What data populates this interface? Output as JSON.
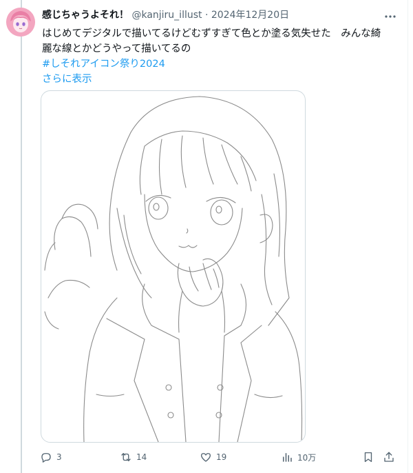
{
  "tweet": {
    "display_name": "感じちゃうよそれ！",
    "handle": "@kanjiru_illust",
    "separator": "·",
    "date": "2024年12月20日",
    "text_line1": "はじめてデジタルで描いてるけどむずすぎて色とか塗る気失せた　みんな綺",
    "text_line2": "麗な線とかどうやって描いてるの",
    "hashtag": "#しそれアイコン祭り2024",
    "show_more": "さらに表示"
  },
  "actions": {
    "replies": "3",
    "reposts": "14",
    "likes": "19",
    "views": "10万"
  },
  "icons": {
    "more": "more-icon",
    "reply": "reply-icon",
    "repost": "repost-icon",
    "like": "heart-icon",
    "views": "views-icon",
    "bookmark": "bookmark-icon",
    "share": "share-icon"
  },
  "colors": {
    "accent": "#1d9bf0",
    "secondary_text": "#536471",
    "border": "#cfd9de"
  }
}
